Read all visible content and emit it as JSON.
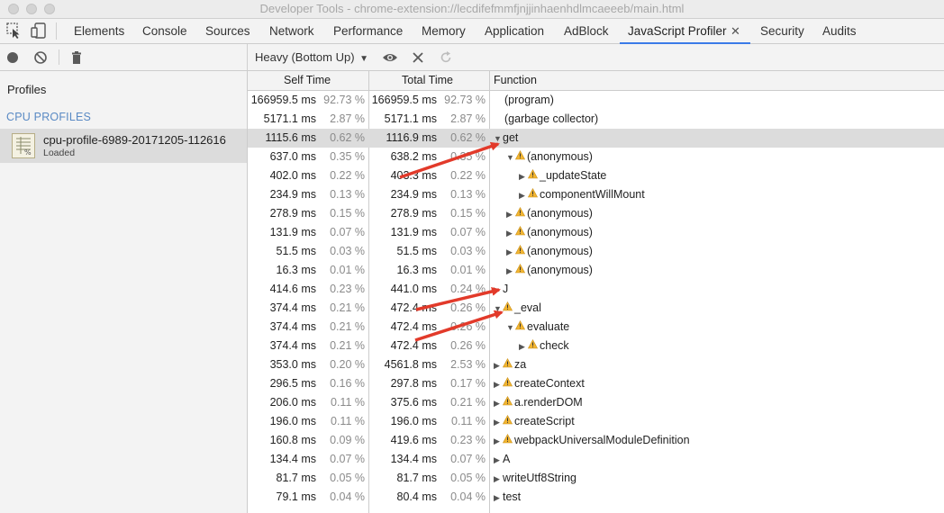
{
  "window": {
    "title": "Developer Tools - chrome-extension://lecdifefmmfjnjjinhaenhdlmcaeeeb/main.html"
  },
  "tabs": [
    "Elements",
    "Console",
    "Sources",
    "Network",
    "Performance",
    "Memory",
    "Application",
    "AdBlock",
    "JavaScript Profiler",
    "Security",
    "Audits"
  ],
  "active_tab": "JavaScript Profiler",
  "toolbar": {
    "view_mode": "Heavy (Bottom Up)"
  },
  "sidebar": {
    "title": "Profiles",
    "section": "CPU PROFILES",
    "profile": {
      "name": "cpu-profile-6989-20171205-112616",
      "status": "Loaded"
    }
  },
  "columns": {
    "self": "Self Time",
    "total": "Total Time",
    "function": "Function"
  },
  "colors": {
    "accent": "#3b7be8",
    "warning": "#f2b531",
    "arrow": "#e23a2a"
  },
  "rows": [
    {
      "self": "166959.5 ms",
      "self_pct": "92.73 %",
      "total": "166959.5 ms",
      "total_pct": "92.73 %",
      "fn": "(program)",
      "indent": 0,
      "tri": "",
      "warn": false
    },
    {
      "self": "5171.1 ms",
      "self_pct": "2.87 %",
      "total": "5171.1 ms",
      "total_pct": "2.87 %",
      "fn": "(garbage collector)",
      "indent": 0,
      "tri": "",
      "warn": false
    },
    {
      "self": "1115.6 ms",
      "self_pct": "0.62 %",
      "total": "1116.9 ms",
      "total_pct": "0.62 %",
      "fn": "get",
      "indent": 0,
      "tri": "▼",
      "warn": false,
      "selected": true
    },
    {
      "self": "637.0 ms",
      "self_pct": "0.35 %",
      "total": "638.2 ms",
      "total_pct": "0.35 %",
      "fn": "(anonymous)",
      "indent": 1,
      "tri": "▼",
      "warn": true
    },
    {
      "self": "402.0 ms",
      "self_pct": "0.22 %",
      "total": "403.3 ms",
      "total_pct": "0.22 %",
      "fn": "_updateState",
      "indent": 2,
      "tri": "▶",
      "warn": true
    },
    {
      "self": "234.9 ms",
      "self_pct": "0.13 %",
      "total": "234.9 ms",
      "total_pct": "0.13 %",
      "fn": "componentWillMount",
      "indent": 2,
      "tri": "▶",
      "warn": true
    },
    {
      "self": "278.9 ms",
      "self_pct": "0.15 %",
      "total": "278.9 ms",
      "total_pct": "0.15 %",
      "fn": "(anonymous)",
      "indent": 1,
      "tri": "▶",
      "warn": true
    },
    {
      "self": "131.9 ms",
      "self_pct": "0.07 %",
      "total": "131.9 ms",
      "total_pct": "0.07 %",
      "fn": "(anonymous)",
      "indent": 1,
      "tri": "▶",
      "warn": true
    },
    {
      "self": "51.5 ms",
      "self_pct": "0.03 %",
      "total": "51.5 ms",
      "total_pct": "0.03 %",
      "fn": "(anonymous)",
      "indent": 1,
      "tri": "▶",
      "warn": true
    },
    {
      "self": "16.3 ms",
      "self_pct": "0.01 %",
      "total": "16.3 ms",
      "total_pct": "0.01 %",
      "fn": "(anonymous)",
      "indent": 1,
      "tri": "▶",
      "warn": true
    },
    {
      "self": "414.6 ms",
      "self_pct": "0.23 %",
      "total": "441.0 ms",
      "total_pct": "0.24 %",
      "fn": "J",
      "indent": 0,
      "tri": "▶",
      "warn": false
    },
    {
      "self": "374.4 ms",
      "self_pct": "0.21 %",
      "total": "472.4 ms",
      "total_pct": "0.26 %",
      "fn": "_eval",
      "indent": 0,
      "tri": "▼",
      "warn": true
    },
    {
      "self": "374.4 ms",
      "self_pct": "0.21 %",
      "total": "472.4 ms",
      "total_pct": "0.26 %",
      "fn": "evaluate",
      "indent": 1,
      "tri": "▼",
      "warn": true
    },
    {
      "self": "374.4 ms",
      "self_pct": "0.21 %",
      "total": "472.4 ms",
      "total_pct": "0.26 %",
      "fn": "check",
      "indent": 2,
      "tri": "▶",
      "warn": true
    },
    {
      "self": "353.0 ms",
      "self_pct": "0.20 %",
      "total": "4561.8 ms",
      "total_pct": "2.53 %",
      "fn": "za",
      "indent": 0,
      "tri": "▶",
      "warn": true
    },
    {
      "self": "296.5 ms",
      "self_pct": "0.16 %",
      "total": "297.8 ms",
      "total_pct": "0.17 %",
      "fn": "createContext",
      "indent": 0,
      "tri": "▶",
      "warn": true
    },
    {
      "self": "206.0 ms",
      "self_pct": "0.11 %",
      "total": "375.6 ms",
      "total_pct": "0.21 %",
      "fn": "a.renderDOM",
      "indent": 0,
      "tri": "▶",
      "warn": true
    },
    {
      "self": "196.0 ms",
      "self_pct": "0.11 %",
      "total": "196.0 ms",
      "total_pct": "0.11 %",
      "fn": "createScript",
      "indent": 0,
      "tri": "▶",
      "warn": true
    },
    {
      "self": "160.8 ms",
      "self_pct": "0.09 %",
      "total": "419.6 ms",
      "total_pct": "0.23 %",
      "fn": "webpackUniversalModuleDefinition",
      "indent": 0,
      "tri": "▶",
      "warn": true
    },
    {
      "self": "134.4 ms",
      "self_pct": "0.07 %",
      "total": "134.4 ms",
      "total_pct": "0.07 %",
      "fn": "A",
      "indent": 0,
      "tri": "▶",
      "warn": false
    },
    {
      "self": "81.7 ms",
      "self_pct": "0.05 %",
      "total": "81.7 ms",
      "total_pct": "0.05 %",
      "fn": "writeUtf8String",
      "indent": 0,
      "tri": "▶",
      "warn": false
    },
    {
      "self": "79.1 ms",
      "self_pct": "0.04 %",
      "total": "80.4 ms",
      "total_pct": "0.04 %",
      "fn": "test",
      "indent": 0,
      "tri": "▶",
      "warn": false
    }
  ]
}
